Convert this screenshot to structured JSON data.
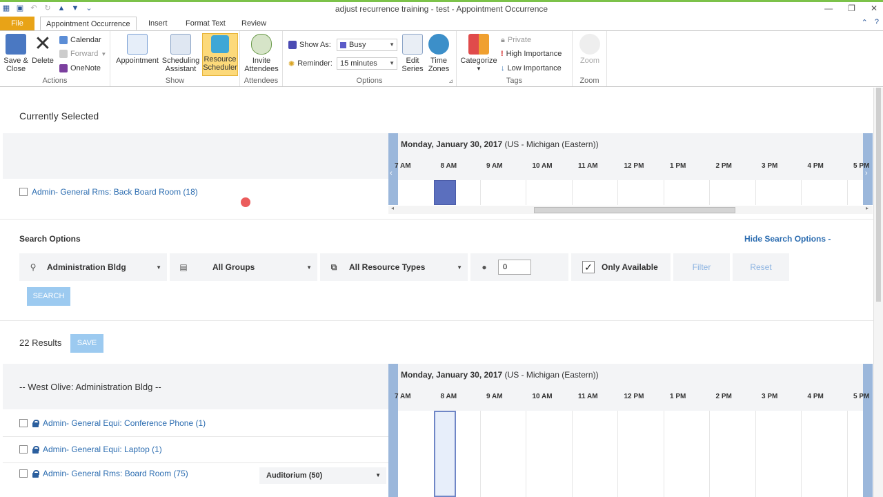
{
  "window": {
    "title": "adjust recurrence training - test  -  Appointment Occurrence"
  },
  "tabs": {
    "file": "File",
    "appointment_occurrence": "Appointment Occurrence",
    "insert": "Insert",
    "format_text": "Format Text",
    "review": "Review"
  },
  "ribbon": {
    "actions": {
      "label": "Actions",
      "save_close": "Save &\nClose",
      "delete": "Delete",
      "calendar": "Calendar",
      "forward": "Forward",
      "onenote": "OneNote"
    },
    "show": {
      "label": "Show",
      "appointment": "Appointment",
      "scheduling_assistant": "Scheduling\nAssistant",
      "resource_scheduler": "Resource\nScheduler"
    },
    "attendees": {
      "label": "Attendees",
      "invite_attendees": "Invite\nAttendees"
    },
    "options": {
      "label": "Options",
      "show_as_label": "Show As:",
      "show_as_value": "Busy",
      "reminder_label": "Reminder:",
      "reminder_value": "15 minutes",
      "edit_series": "Edit\nSeries",
      "time_zones": "Time\nZones"
    },
    "tags": {
      "label": "Tags",
      "categorize": "Categorize",
      "private": "Private",
      "high_importance": "High Importance",
      "low_importance": "Low Importance"
    },
    "zoom": {
      "label": "Zoom",
      "zoom": "Zoom"
    }
  },
  "currently_selected": {
    "title": "Currently Selected",
    "resource": "Admin- General Rms: Back Board Room (18)"
  },
  "timeline": {
    "date": "Monday, January 30, 2017",
    "timezone": "(US - Michigan (Eastern))",
    "hours": [
      "7 AM",
      "8 AM",
      "9 AM",
      "10 AM",
      "11 AM",
      "12 PM",
      "1 PM",
      "2 PM",
      "3 PM",
      "4 PM",
      "5 PM"
    ]
  },
  "search_options": {
    "title": "Search Options",
    "hide_link": "Hide Search Options -",
    "building": "Administration Bldg",
    "groups": "All Groups",
    "resource_types": "All Resource Types",
    "capacity": "0",
    "only_available": "Only Available",
    "filter": "Filter",
    "reset": "Reset",
    "search_button": "SEARCH"
  },
  "results": {
    "count_label": "22 Results",
    "save_button": "SAVE",
    "group_header": "-- West Olive: Administration Bldg --",
    "items": [
      "Admin- General Equi: Conference Phone (1)",
      "Admin- General Equi: Laptop (1)",
      "Admin- General Rms: Board Room (75)"
    ],
    "layout_select": "Auditorium (50)"
  }
}
